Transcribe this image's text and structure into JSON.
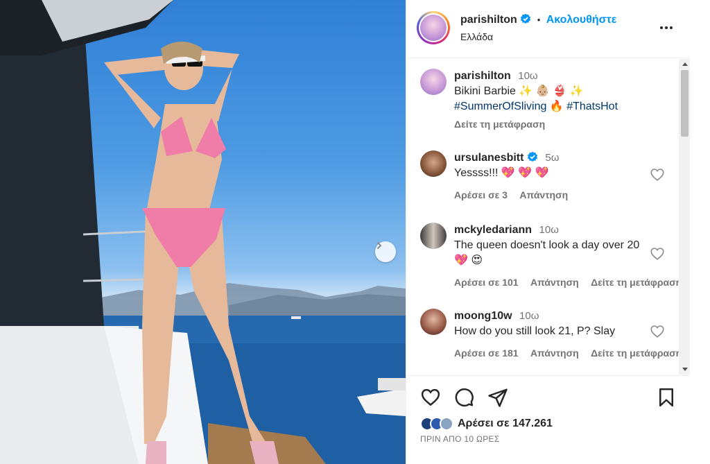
{
  "post": {
    "username": "parishilton",
    "follow_label": "Ακολουθήστε",
    "separator": "•",
    "location": "Ελλάδα"
  },
  "caption": {
    "username": "parishilton",
    "time": "10ω",
    "line1": "Bikini Barbie ✨ 👶🏼 👙 ✨",
    "hashtag1": "#SummerOfSliving",
    "fire": "🔥",
    "hashtag2": "#ThatsHot",
    "translate": "Δείτε τη μετάφραση"
  },
  "comments": [
    {
      "username": "ursulanesbitt",
      "verified": true,
      "time": "5ω",
      "text": "Yessss!!! 💖 💖 💖",
      "likes": "Αρέσει σε 3",
      "reply": "Απάντηση",
      "translate": ""
    },
    {
      "username": "mckyledariann",
      "verified": false,
      "time": "10ω",
      "text": "The queen doesn't look a day over 20 💖 😍",
      "likes": "Αρέσει σε 101",
      "reply": "Απάντηση",
      "translate": "Δείτε τη μετάφραση"
    },
    {
      "username": "moong10w",
      "verified": false,
      "time": "10ω",
      "text": "How do you still look 21, P? Slay",
      "likes": "Αρέσει σε 181",
      "reply": "Απάντηση",
      "translate": "Δείτε τη μετάφραση"
    }
  ],
  "footer": {
    "likes": "Αρέσει σε 147.261",
    "posted": "ΠΡΙΝ ΑΠΟ 10 ΩΡΕΣ"
  },
  "colors": {
    "link": "#0095f6",
    "hashtag": "#00376b",
    "muted": "#737373",
    "verified": "#0095f6"
  },
  "icons": [
    "more-icon",
    "chevron-right-icon",
    "heart-icon",
    "comment-icon",
    "share-icon",
    "bookmark-icon",
    "verified-badge-icon"
  ]
}
